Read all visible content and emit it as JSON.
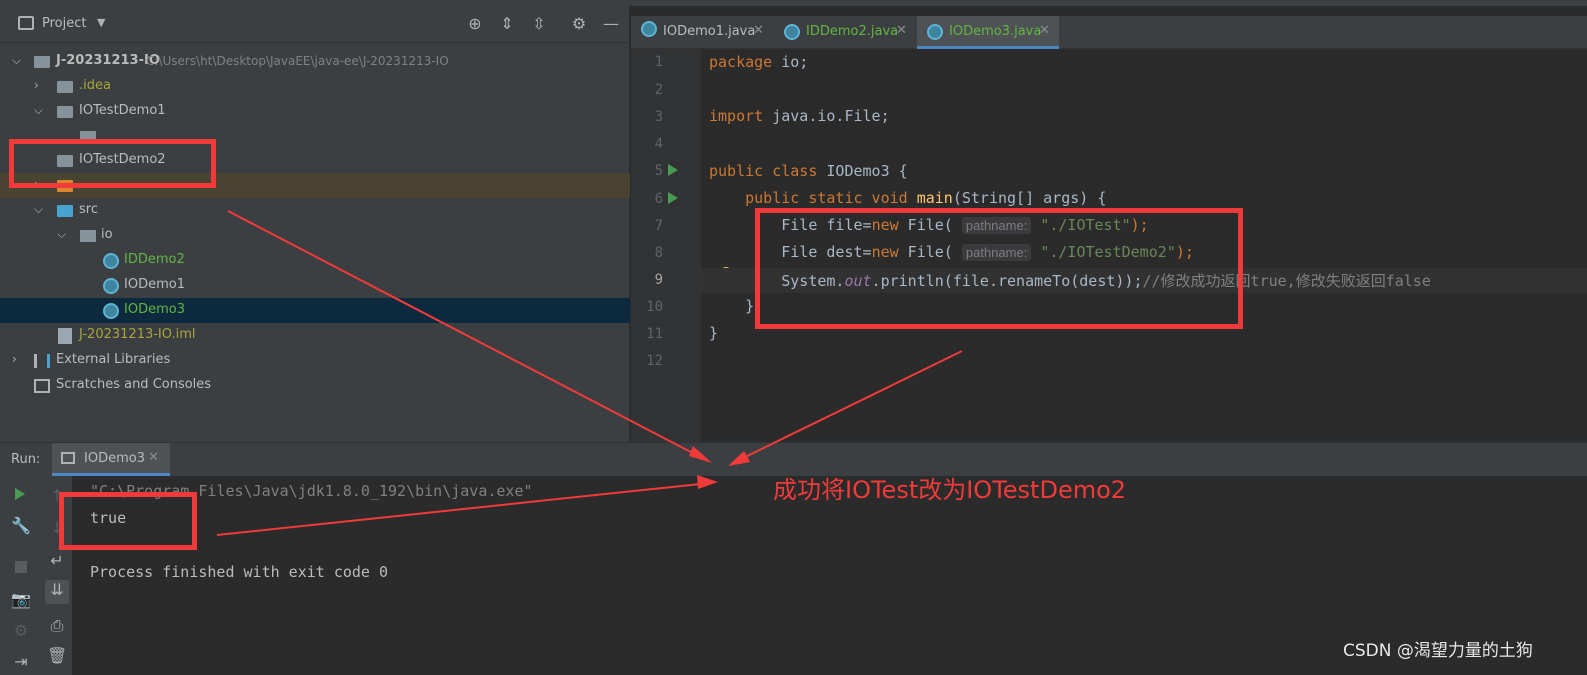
{
  "project_panel": {
    "title": "Project",
    "tree": [
      {
        "label": "J-20231213-IO",
        "path": "C:\\Users\\ht\\Desktop\\JavaEE\\java-ee\\J-20231213-IO"
      },
      {
        "label": ".idea"
      },
      {
        "label": "IOTestDemo1"
      },
      {
        "label": "IOTestDemo2"
      },
      {
        "label": "src"
      },
      {
        "label": "io"
      },
      {
        "label": "IDDemo2"
      },
      {
        "label": "IODemo1"
      },
      {
        "label": "IODemo3"
      },
      {
        "label": "J-20231213-IO.iml"
      },
      {
        "label": "External Libraries"
      },
      {
        "label": "Scratches and Consoles"
      }
    ]
  },
  "editor": {
    "tabs": [
      {
        "label": "IODemo1.java"
      },
      {
        "label": "IDDemo2.java"
      },
      {
        "label": "IODemo3.java"
      }
    ],
    "line_numbers": [
      "1",
      "2",
      "3",
      "4",
      "5",
      "6",
      "7",
      "8",
      "9",
      "10",
      "11",
      "12"
    ],
    "code": {
      "l1_kw": "package",
      "l1_rest": " io;",
      "l3_kw": "import",
      "l3_rest": " java.io.File;",
      "l5_kw": "public class",
      "l5_rest": " IODemo3 {",
      "l6_kw": "public static void",
      "l6_fn": "main",
      "l6_rest": "(String[] args) {",
      "l7_a": "File file=",
      "l7_kw": "new",
      "l7_b": " File(",
      "l7_hint": "pathname:",
      "l7_str": "\"./IOTest\"",
      "l7_c": ");",
      "l8_a": "File dest=",
      "l8_kw": "new",
      "l8_b": " File(",
      "l8_hint": "pathname:",
      "l8_str": "\"./IOTestDemo2\"",
      "l8_c": ");",
      "l9_a": "System.",
      "l9_field": "out",
      "l9_b": ".println(file.renameTo(dest));",
      "l9_comment": "//修改成功返回true,修改失败返回false",
      "l10": "}",
      "l11": "}"
    }
  },
  "run_panel": {
    "label": "Run:",
    "tab": "IODemo3",
    "console": [
      "\"C:\\Program Files\\Java\\jdk1.8.0_192\\bin\\java.exe\"",
      "true",
      "",
      "Process finished with exit code 0"
    ]
  },
  "annotation": {
    "text": "成功将IOTest改为IOTestDemo2",
    "color": "#f23a3a"
  },
  "watermark": "CSDN @渴望力量的土狗"
}
